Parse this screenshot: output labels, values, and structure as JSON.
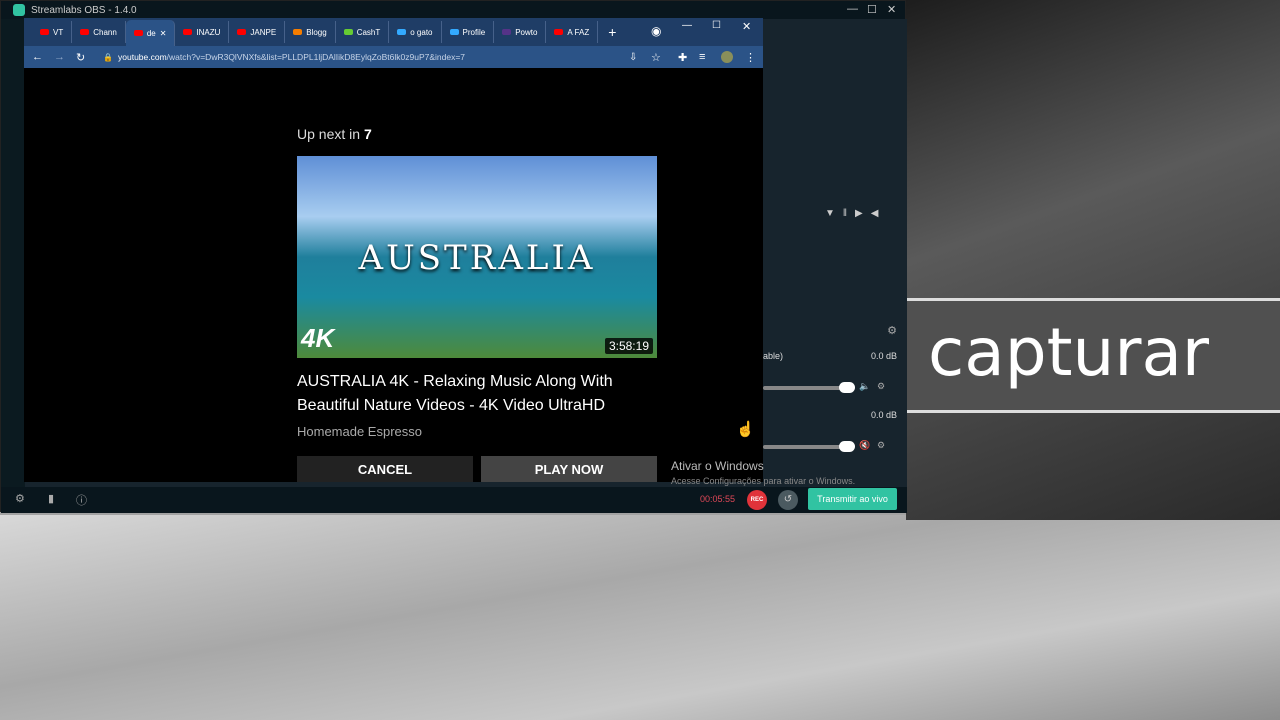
{
  "obs": {
    "title": "Streamlabs OBS - 1.4.0",
    "timer": "00:05:55",
    "rec_label": "REC",
    "live_label": "Transmitir ao vivo",
    "mixer": [
      {
        "name": "able)",
        "level": "0.0 dB"
      },
      {
        "name": "",
        "level": "0.0 dB"
      }
    ]
  },
  "browser": {
    "tabs": [
      {
        "label": "VT",
        "icon": "youtube"
      },
      {
        "label": "Chann",
        "icon": "youtube"
      },
      {
        "label": "de",
        "icon": "youtube",
        "active": true
      },
      {
        "label": "INAZU",
        "icon": "youtube"
      },
      {
        "label": "JANPE",
        "icon": "youtube"
      },
      {
        "label": "Blogg",
        "icon": "blogger"
      },
      {
        "label": "CashT",
        "icon": "cashtab"
      },
      {
        "label": "o gato",
        "icon": "play"
      },
      {
        "label": "Profile",
        "icon": "play"
      },
      {
        "label": "Powto",
        "icon": "powtoon"
      },
      {
        "label": "A FAZ",
        "icon": "youtube"
      }
    ],
    "url_domain": "youtube.com",
    "url_path": "/watch?v=DwR3QlVNXfs&list=PLLDPL1ljDAlIikD8EylqZoBt6lk0z9uP7&index=7"
  },
  "player": {
    "upnext_prefix": "Up next in ",
    "countdown": "7",
    "thumb_text": "AUSTRALIA",
    "thumb_badge": "4K",
    "duration": "3:58:19",
    "video_title": "AUSTRALIA 4K - Relaxing Music Along With Beautiful Nature Videos - 4K Video UltraHD",
    "channel": "Homemade Espresso",
    "cancel": "CANCEL",
    "play_now": "PLAY NOW"
  },
  "windows": {
    "activate_title": "Ativar o Windows",
    "activate_sub": "Acesse Configurações para ativar o Windows."
  },
  "overlay": {
    "text": "capturar"
  },
  "colors": {
    "accent": "#31c3a2",
    "rec": "#e0333a",
    "chrome_tabbar": "#1f3d66"
  }
}
